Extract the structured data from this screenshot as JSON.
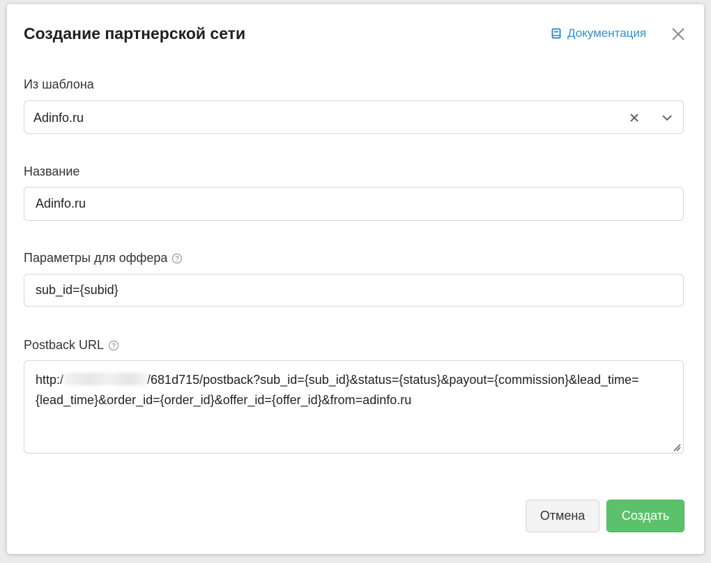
{
  "dialog": {
    "title": "Создание партнерской сети",
    "docs_link": "Документация"
  },
  "template": {
    "label": "Из шаблона",
    "selected": "Adinfo.ru"
  },
  "name": {
    "label": "Название",
    "value": "Adinfo.ru"
  },
  "offer_params": {
    "label": "Параметры для оффера",
    "value": "sub_id={subid}"
  },
  "postback": {
    "label": "Postback URL",
    "value_prefix": "http:/",
    "value_rest": "/681d715/postback?sub_id={sub_id}&status={status}&payout={commission}&lead_time={lead_time}&order_id={order_id}&offer_id={offer_id}&from=adinfo.ru"
  },
  "buttons": {
    "cancel": "Отмена",
    "create": "Создать"
  },
  "icons": {
    "docs": "book-icon",
    "close": "close-icon",
    "clear": "clear-x-icon",
    "chevron": "chevron-down-icon",
    "help": "help-circle-icon",
    "resize": "resize-handle-icon"
  },
  "colors": {
    "link": "#2f8fd6",
    "primary_button": "#5cc16b",
    "field_border": "#d7d7d7"
  }
}
